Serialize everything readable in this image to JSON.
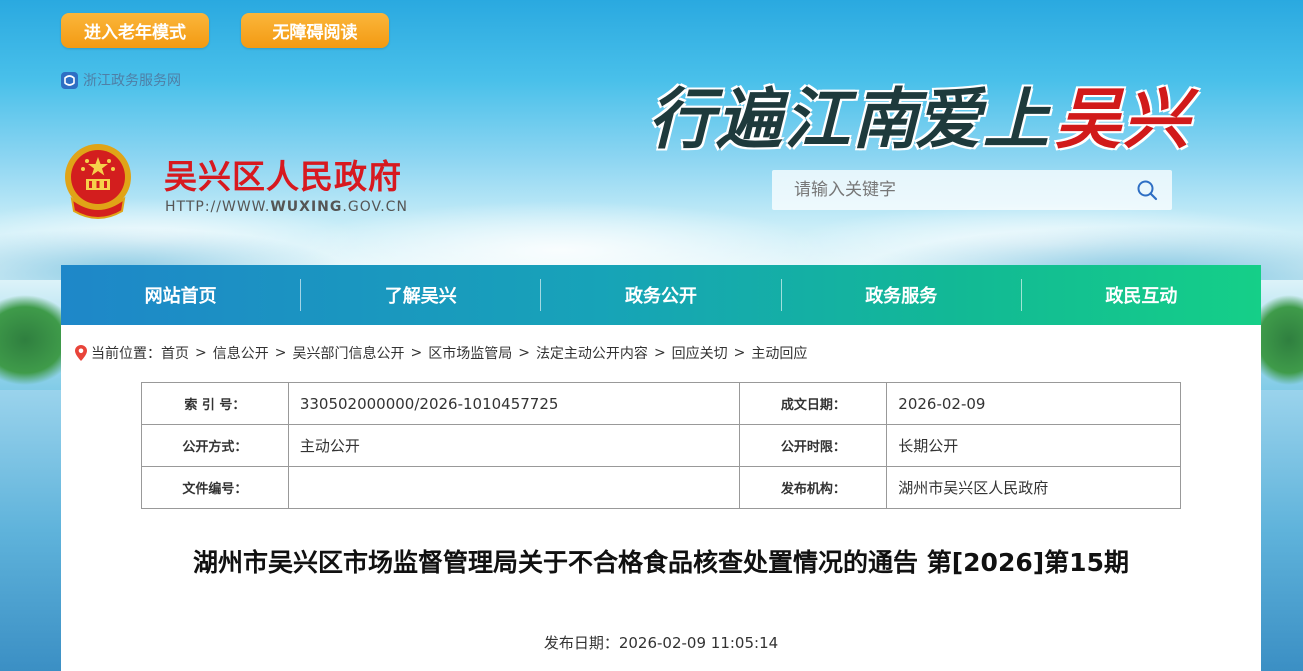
{
  "top_buttons": {
    "elder_mode": "进入老年模式",
    "accessible_reading": "无障碍阅读"
  },
  "gov_portal_link": "浙江政务服务网",
  "site": {
    "title": "吴兴区人民政府",
    "url_prefix": "HTTP://WWW.",
    "url_domain": "WUXING",
    "url_suffix": ".GOV.CN",
    "slogan_main": "行遍江南",
    "slogan_accent_1": "爱上",
    "slogan_accent_2": "吴兴"
  },
  "search": {
    "placeholder": "请输入关键字"
  },
  "nav": {
    "items": [
      "网站首页",
      "了解吴兴",
      "政务公开",
      "政务服务",
      "政民互动"
    ]
  },
  "breadcrumb": {
    "label": "当前位置：",
    "items": [
      "首页",
      "信息公开",
      "吴兴部门信息公开",
      "区市场监管局",
      "法定主动公开内容",
      "回应关切",
      "主动回应"
    ],
    "separator": ">"
  },
  "meta": {
    "rows": [
      {
        "label_a": "索 引 号：",
        "value_a": "330502000000/2026-1010457725",
        "label_b": "成文日期：",
        "value_b": "2026-02-09"
      },
      {
        "label_a": "公开方式：",
        "value_a": "主动公开",
        "label_b": "公开时限：",
        "value_b": "长期公开"
      },
      {
        "label_a": "文件编号：",
        "value_a": "",
        "label_b": "发布机构：",
        "value_b": "湖州市吴兴区人民政府"
      }
    ]
  },
  "article": {
    "title": "湖州市吴兴区市场监督管理局关于不合格食品核查处置情况的通告 第[2026]第15期",
    "publish_date_label": "发布日期：",
    "publish_date": "2026-02-09 11:05:14"
  },
  "colors": {
    "accent_orange": "#f39a12",
    "title_red": "#d7191f",
    "nav_start": "#1e87c9",
    "nav_end": "#15cf88"
  }
}
